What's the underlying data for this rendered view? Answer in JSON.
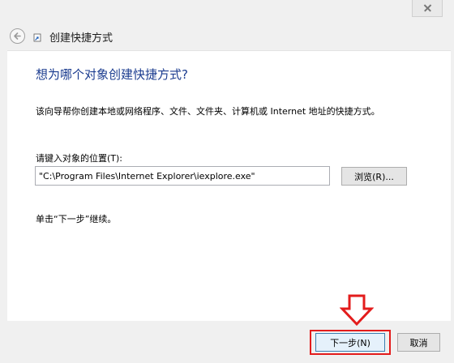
{
  "window": {
    "title": "创建快捷方式",
    "close_icon": "close-icon",
    "back_icon": "back-arrow-icon",
    "wizard_icon": "shortcut-wizard-icon"
  },
  "page": {
    "question": "想为哪个对象创建快捷方式?",
    "description": "该向导帮你创建本地或网络程序、文件、文件夹、计算机或 Internet 地址的快捷方式。",
    "location_label": "请键入对象的位置(T):",
    "location_value": "\"C:\\Program Files\\Internet Explorer\\iexplore.exe\"",
    "browse_label": "浏览(R)...",
    "hint": "单击“下一步”继续。"
  },
  "footer": {
    "next_label": "下一步(N)",
    "cancel_label": "取消"
  },
  "colors": {
    "question_text": "#1a3b8f",
    "annotation_red": "#e31c1c",
    "default_button_border": "#3c7fb1"
  }
}
